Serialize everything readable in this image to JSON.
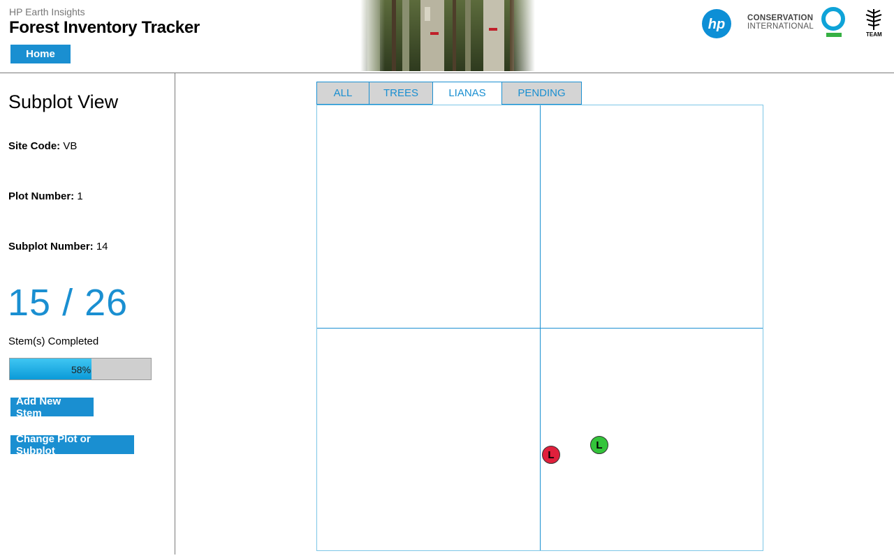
{
  "header": {
    "app_subtitle": "HP Earth Insights",
    "app_title": "Forest Inventory Tracker",
    "home_label": "Home",
    "logos": {
      "hp": "hp",
      "ci_line1": "CONSERVATION",
      "ci_line2": "INTERNATIONAL",
      "team": "TEAM"
    }
  },
  "sidebar": {
    "title": "Subplot View",
    "site_code_label": "Site Code:",
    "site_code_value": "VB",
    "plot_number_label": "Plot Number:",
    "plot_number_value": "1",
    "subplot_number_label": "Subplot Number:",
    "subplot_number_value": "14",
    "counter": "15 / 26",
    "counter_label": "Stem(s) Completed",
    "progress_percent": 58,
    "progress_text": "58%",
    "add_stem_label": "Add New Stem",
    "change_plot_label": "Change Plot or Subplot"
  },
  "tabs": [
    {
      "label": "ALL",
      "active": false
    },
    {
      "label": "TREES",
      "active": false
    },
    {
      "label": "LIANAS",
      "active": true
    },
    {
      "label": "PENDING",
      "active": false
    }
  ],
  "stems": [
    {
      "label": "L",
      "status": "incomplete",
      "color": "#e0203c"
    },
    {
      "label": "L",
      "status": "complete",
      "color": "#33c43a"
    }
  ],
  "colors": {
    "accent": "#1a8fd1",
    "stem_incomplete": "#e0203c",
    "stem_complete": "#33c43a"
  }
}
